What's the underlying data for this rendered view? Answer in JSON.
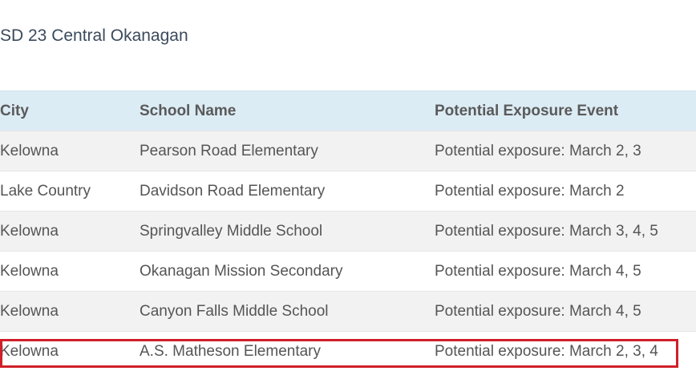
{
  "district": {
    "title": "SD 23 Central Okanagan"
  },
  "table": {
    "headers": {
      "city": "City",
      "school": "School Name",
      "event": "Potential Exposure Event"
    },
    "rows": [
      {
        "city": "Kelowna",
        "school": "Pearson Road Elementary",
        "event": "Potential exposure: March 2, 3"
      },
      {
        "city": "Lake Country",
        "school": "Davidson Road Elementary",
        "event": "Potential exposure: March 2"
      },
      {
        "city": "Kelowna",
        "school": "Springvalley Middle School",
        "event": "Potential exposure: March 3, 4, 5"
      },
      {
        "city": "Kelowna",
        "school": "Okanagan Mission Secondary",
        "event": "Potential exposure: March 4, 5"
      },
      {
        "city": "Kelowna",
        "school": "Canyon Falls Middle School",
        "event": "Potential exposure: March 4, 5"
      },
      {
        "city": "Kelowna",
        "school": "A.S. Matheson Elementary",
        "event": "Potential exposure: March 2, 3, 4"
      }
    ]
  },
  "highlight": {
    "color": "#d0202a"
  }
}
